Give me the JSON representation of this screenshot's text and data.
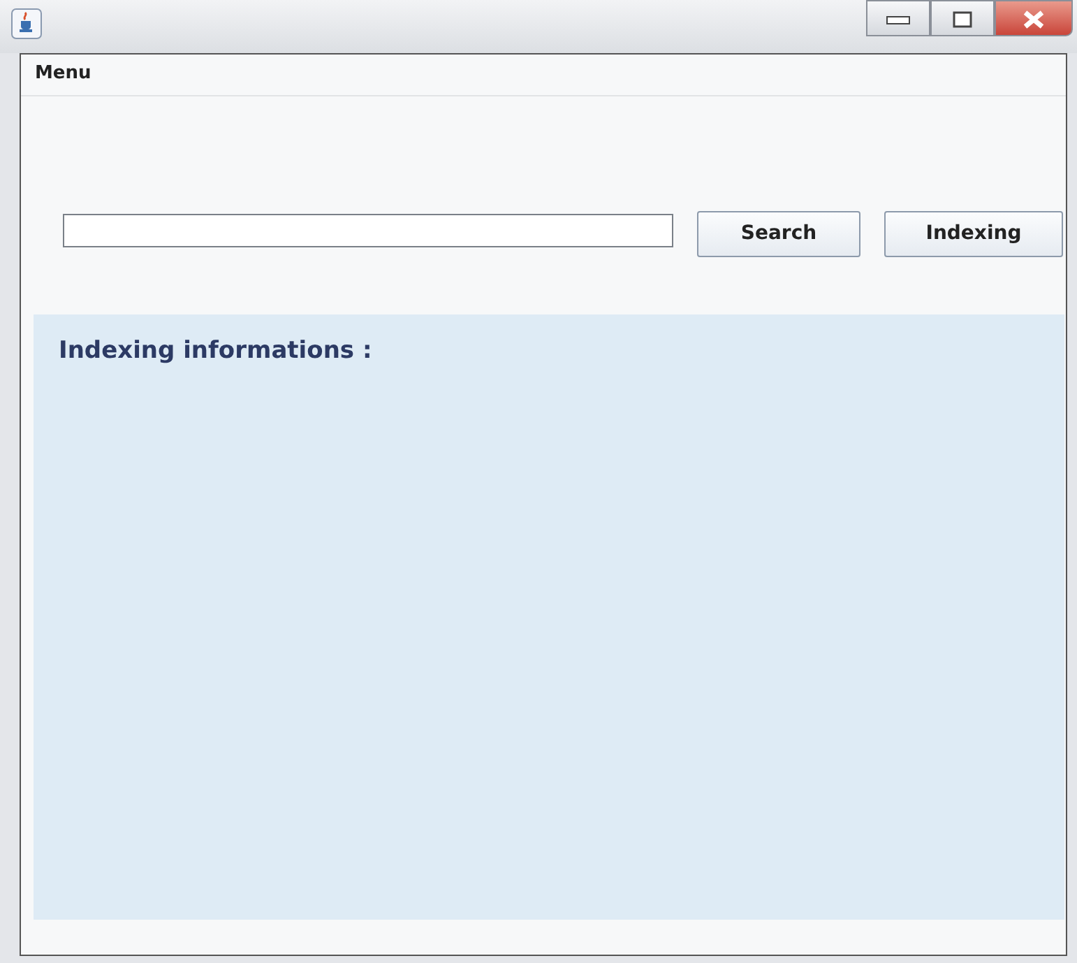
{
  "menu_bar": {
    "items": [
      "Menu"
    ]
  },
  "buttons": [
    "Search",
    "Indexing"
  ],
  "info_panel": {
    "title": "Indexing informations :"
  }
}
